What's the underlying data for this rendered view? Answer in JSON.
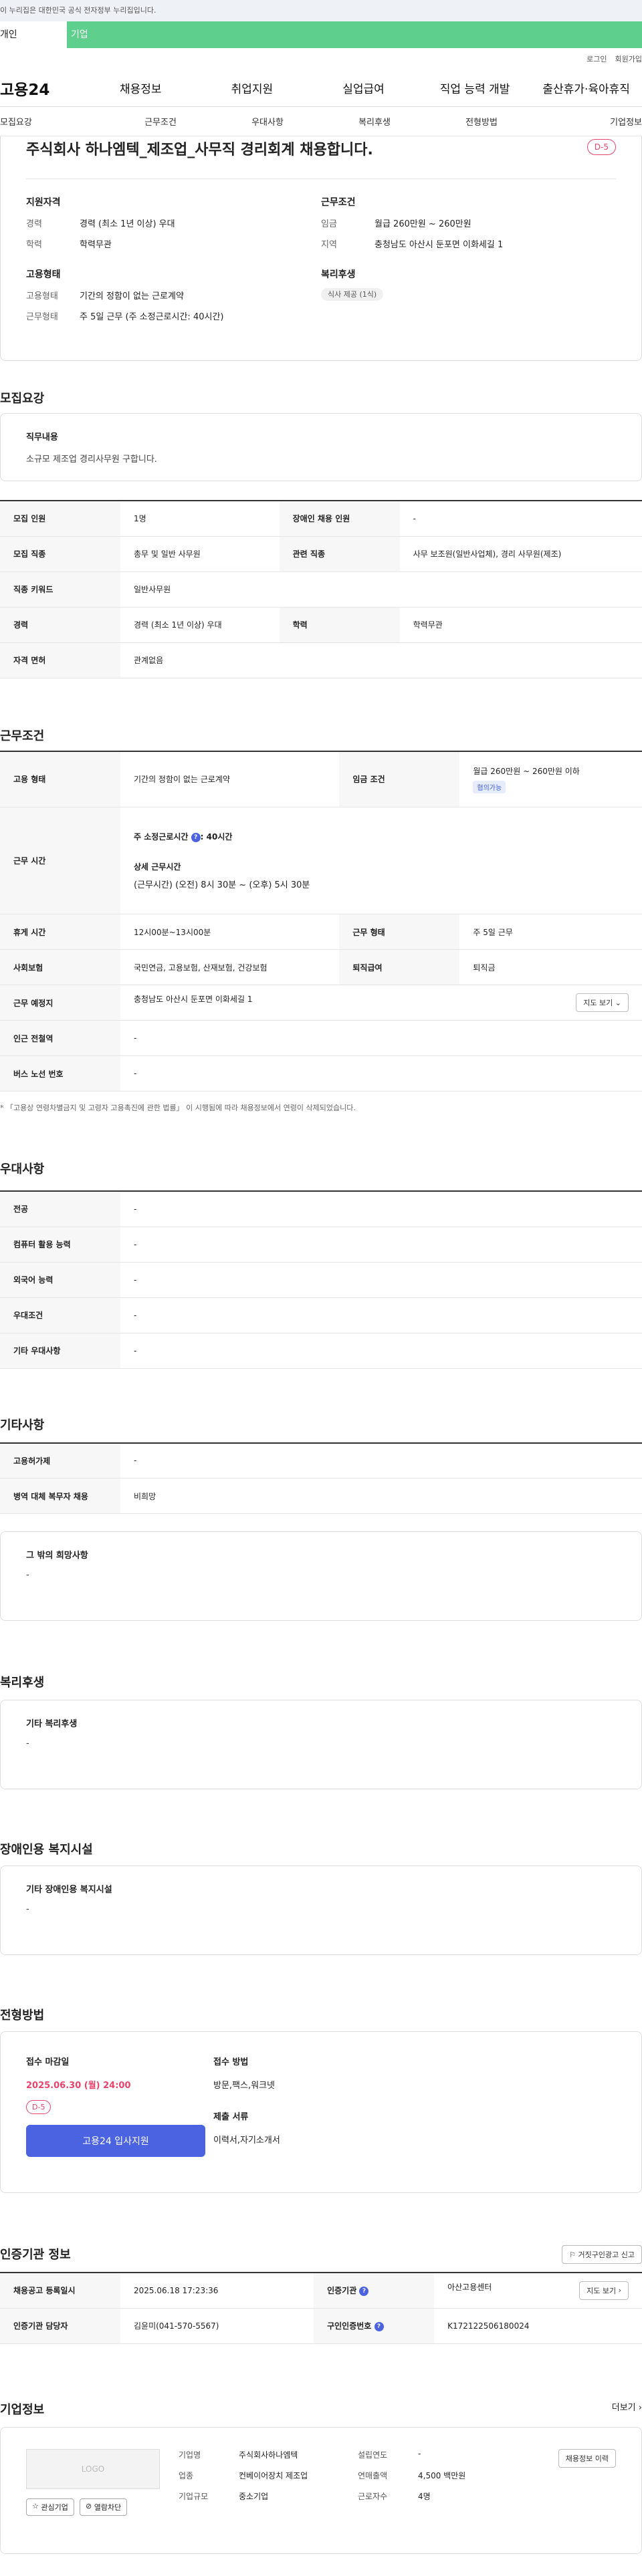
{
  "notice": "이 누리집은 대한민국 공식 전자정부 누리집입니다.",
  "topbar": {
    "left": "개인",
    "right": "기업"
  },
  "util": {
    "login": "로그인",
    "join": "회원가입"
  },
  "gnb": {
    "logo": "고용24",
    "items": [
      "채용정보",
      "취업지원",
      "실업급여",
      "직업 능력 개발",
      "출산휴가·육아휴직"
    ]
  },
  "anchors": [
    "모집요강",
    "근무조건",
    "우대사항",
    "복리후생",
    "전형방법",
    "기업정보"
  ],
  "summary": {
    "title": "주식회사 하나엠텍_제조업_사무직 경리회계 채용합니다.",
    "dday": "D-5",
    "qual": {
      "h": "지원자격",
      "rows": [
        [
          "경력",
          "경력 (최소 1년 이상) 우대"
        ],
        [
          "학력",
          "학력무관"
        ]
      ]
    },
    "cond": {
      "h": "근무조건",
      "rows": [
        [
          "임금",
          "월급 260만원 ~ 260만원"
        ],
        [
          "지역",
          "충청남도 아산시 둔포면 이화세길 1"
        ]
      ]
    },
    "emp": {
      "h": "고용형태",
      "rows": [
        [
          "고용형태",
          "기간의 정함이 없는 근로계약"
        ],
        [
          "근무형태",
          "주 5일 근무 (주 소정근로시간: 40시간)"
        ]
      ]
    },
    "welfare": {
      "h": "복리후생",
      "chip": "식사 제공 (1식)"
    }
  },
  "recruit": {
    "title": "모집요강",
    "duty_h": "직무내용",
    "duty_v": "소규모 제조업 경리사무원 구합니다.",
    "rows": [
      [
        "모집 인원",
        "1명",
        "장애인 채용 인원",
        "-"
      ],
      [
        "모집 직종",
        "총무 및 일반 사무원",
        "관련 직종",
        "사무 보조원(일반사업체), 경리 사무원(제조)"
      ],
      [
        "직종 키워드",
        "일반사무원"
      ],
      [
        "경력",
        "경력 (최소 1년 이상) 우대",
        "학력",
        "학력무관"
      ],
      [
        "자격 면허",
        "관계없음"
      ]
    ]
  },
  "workcond": {
    "title": "근무조건",
    "emp_k": "고용 형태",
    "emp_v": "기간의 정함이 없는 근로계약",
    "wage_k": "임금 조건",
    "wage_v": "월급 260만원 ~ 260만원 이하",
    "wage_tag": "협의가능",
    "hours_k": "근무 시간",
    "hours_v1": "주 소정근로시간",
    "hours_v1b": "40시간",
    "hours_v2": "상세 근무시간",
    "hours_v3": "(근무시간) (오전) 8시 30분 ~ (오후) 5시 30분",
    "break_k": "휴게 시간",
    "break_v": "12시00분~13시00분",
    "type_k": "근무 형태",
    "type_v": "주 5일 근무",
    "ins_k": "사회보험",
    "ins_v": "국민연금, 고용보험, 산재보험, 건강보험",
    "ret_k": "퇴직급여",
    "ret_v": "퇴직금",
    "place_k": "근무 예정지",
    "place_v": "충청남도 아산시 둔포면 이화세길 1",
    "map_btn": "지도 보기",
    "metro_k": "인근 전철역",
    "metro_v": "-",
    "bus_k": "버스 노선 번호",
    "bus_v": "-",
    "note": "「고용상 연령차별금지 및 고령자 고용촉진에 관한 법률」 이 시행됨에 따라 채용정보에서 연령이 삭제되었습니다."
  },
  "pref": {
    "title": "우대사항",
    "rows": [
      [
        "전공",
        "-"
      ],
      [
        "컴퓨터 활용 능력",
        "-"
      ],
      [
        "외국어 능력",
        "-"
      ],
      [
        "우대조건",
        "-"
      ],
      [
        "기타 우대사항",
        "-"
      ]
    ]
  },
  "etc": {
    "title": "기타사항",
    "rows": [
      [
        "고용허가제",
        "-"
      ],
      [
        "병역 대체 복무자 채용",
        "비희망"
      ]
    ],
    "box_h": "그 밖의 희망사항",
    "box_v": "-"
  },
  "benefit": {
    "title": "복리후생",
    "h": "기타 복리후생",
    "v": "-"
  },
  "disab": {
    "title": "장애인용 복지시설",
    "h": "기타 장애인용 복지시설",
    "v": "-"
  },
  "process": {
    "title": "전형방법",
    "deadline_h": "접수 마감일",
    "deadline": "2025.06.30 (월) 24:00",
    "dday": "D-5",
    "apply": "고용24 입사지원",
    "method_h": "접수 방법",
    "method_v": "방문,팩스,워크넷",
    "docs_h": "제출 서류",
    "docs_v": "이력서,자기소개서"
  },
  "cert": {
    "title": "인증기관 정보",
    "report_btn": "거짓구인광고 신고",
    "reg_k": "채용공고 등록일시",
    "reg_v": "2025.06.18 17:23:36",
    "org_k": "인증기관",
    "org_v": "아산고용센터",
    "map_btn": "지도 보기",
    "mgr_k": "인증기관 담당자",
    "mgr_v": "김윤미(041-570-5567)",
    "no_k": "구인인증번호",
    "no_v": "K172122506180024"
  },
  "company": {
    "title": "기업정보",
    "more": "더보기",
    "logo": "LOGO",
    "fav": "관심기업",
    "block": "열람차단",
    "hist_btn": "채용정보 이력",
    "rows": [
      [
        "기업명",
        "주식회사하나엠텍"
      ],
      [
        "업종",
        "컨베이어장치 제조업"
      ],
      [
        "기업규모",
        "중소기업"
      ]
    ],
    "rows2": [
      [
        "설립연도",
        "-"
      ],
      [
        "연매출액",
        "4,500 백만원"
      ],
      [
        "근로자수",
        "4명"
      ]
    ]
  }
}
